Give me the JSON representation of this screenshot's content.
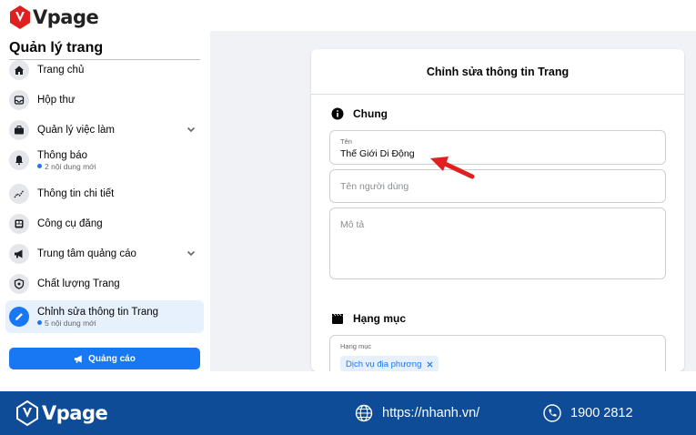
{
  "brand": {
    "logo_text": "Vpage",
    "logo_color": "#e02020"
  },
  "sidebar": {
    "title": "Quản lý trang",
    "items": [
      {
        "label": "Trang chủ",
        "sub": "",
        "icon": "home-icon"
      },
      {
        "label": "Hộp thư",
        "sub": "",
        "icon": "inbox-icon"
      },
      {
        "label": "Quản lý việc làm",
        "sub": "",
        "icon": "briefcase-icon",
        "expand": true
      },
      {
        "label": "Thông báo",
        "sub": "2 nội dung mới",
        "icon": "bell-icon"
      },
      {
        "label": "Thông tin chi tiết",
        "sub": "",
        "icon": "insights-icon"
      },
      {
        "label": "Công cụ đăng",
        "sub": "",
        "icon": "publishing-tools-icon"
      },
      {
        "label": "Trung tâm quảng cáo",
        "sub": "",
        "icon": "megaphone-icon",
        "expand": true
      },
      {
        "label": "Chất lượng Trang",
        "sub": "",
        "icon": "shield-icon"
      },
      {
        "label": "Chỉnh sửa thông tin Trang",
        "sub": "5 nội dung mới",
        "icon": "pencil-icon",
        "active": true
      }
    ],
    "ads_button": "Quảng cáo"
  },
  "card": {
    "title": "Chỉnh sửa thông tin Trang",
    "general": {
      "heading": "Chung",
      "name_label": "Tên",
      "name_value": "Thế Giới Di Động",
      "username_placeholder": "Tên người dùng",
      "description_placeholder": "Mô tả"
    },
    "category": {
      "heading": "Hạng mục",
      "field_label": "Hạng mục",
      "chip": "Dịch vụ địa phương"
    }
  },
  "footer": {
    "logo_text": "Vpage",
    "website": "https://nhanh.vn/",
    "phone": "1900 2812",
    "bg_color": "#0f4c97"
  },
  "colors": {
    "accent": "#1877f2",
    "arrow": "#e02020"
  }
}
